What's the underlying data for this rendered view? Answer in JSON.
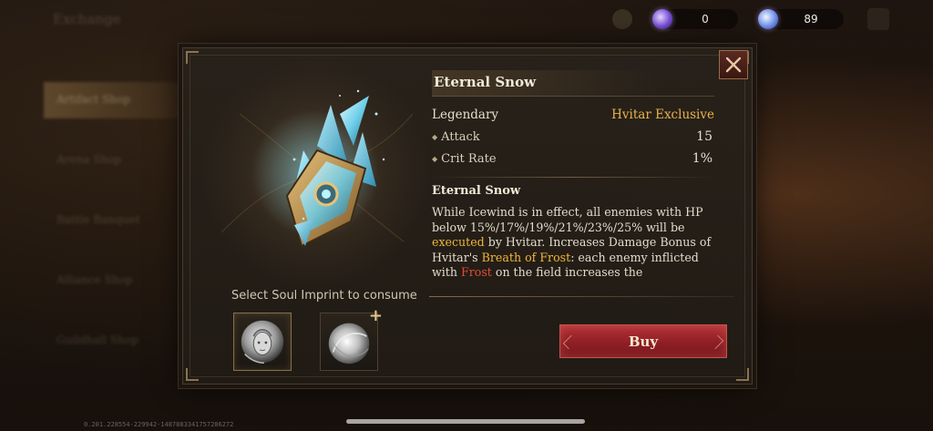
{
  "background": {
    "title": "Exchange",
    "menu": [
      "Artifact Shop",
      "Arena Shop",
      "Battle Banquet",
      "Alliance Shop",
      "Guildhall Shop"
    ]
  },
  "currencies": [
    {
      "icon": "soul-gem-purple-icon",
      "value": "0",
      "color": "#7a4fd8"
    },
    {
      "icon": "soul-gem-blue-icon",
      "value": "89",
      "color": "#6f8fe8"
    }
  ],
  "item": {
    "name": "Eternal Snow",
    "rarity": "Legendary",
    "exclusive": "Hvitar Exclusive",
    "stats": [
      {
        "label": "Attack",
        "value": "15"
      },
      {
        "label": "Crit Rate",
        "value": "1%"
      }
    ],
    "skill_name": "Eternal Snow",
    "description": [
      {
        "text": "While Icewind is in effect, all enemies with HP below 15%/17%/19%/21%/23%/25% will be ",
        "style": ""
      },
      {
        "text": "executed",
        "style": "gold"
      },
      {
        "text": " by Hvitar. Increases Damage Bonus of Hvitar's ",
        "style": ""
      },
      {
        "text": "Breath of Frost",
        "style": "gold"
      },
      {
        "text": ": each enemy inflicted with ",
        "style": ""
      },
      {
        "text": "Frost",
        "style": "red"
      },
      {
        "text": " on the field increases the",
        "style": ""
      }
    ]
  },
  "soul_imprint": {
    "label": "Select Soul Imprint to consume",
    "slots": [
      {
        "name": "soul-imprint-face",
        "selected": true
      },
      {
        "name": "soul-imprint-orb",
        "selected": false,
        "add": "+"
      }
    ]
  },
  "buy_label": "Buy",
  "debug": "0.201.228554-229942-1487883341757286272",
  "colors": {
    "accent_gold": "#f0b63a",
    "accent_red": "#e24b3a",
    "buy_button": "#b53237"
  }
}
